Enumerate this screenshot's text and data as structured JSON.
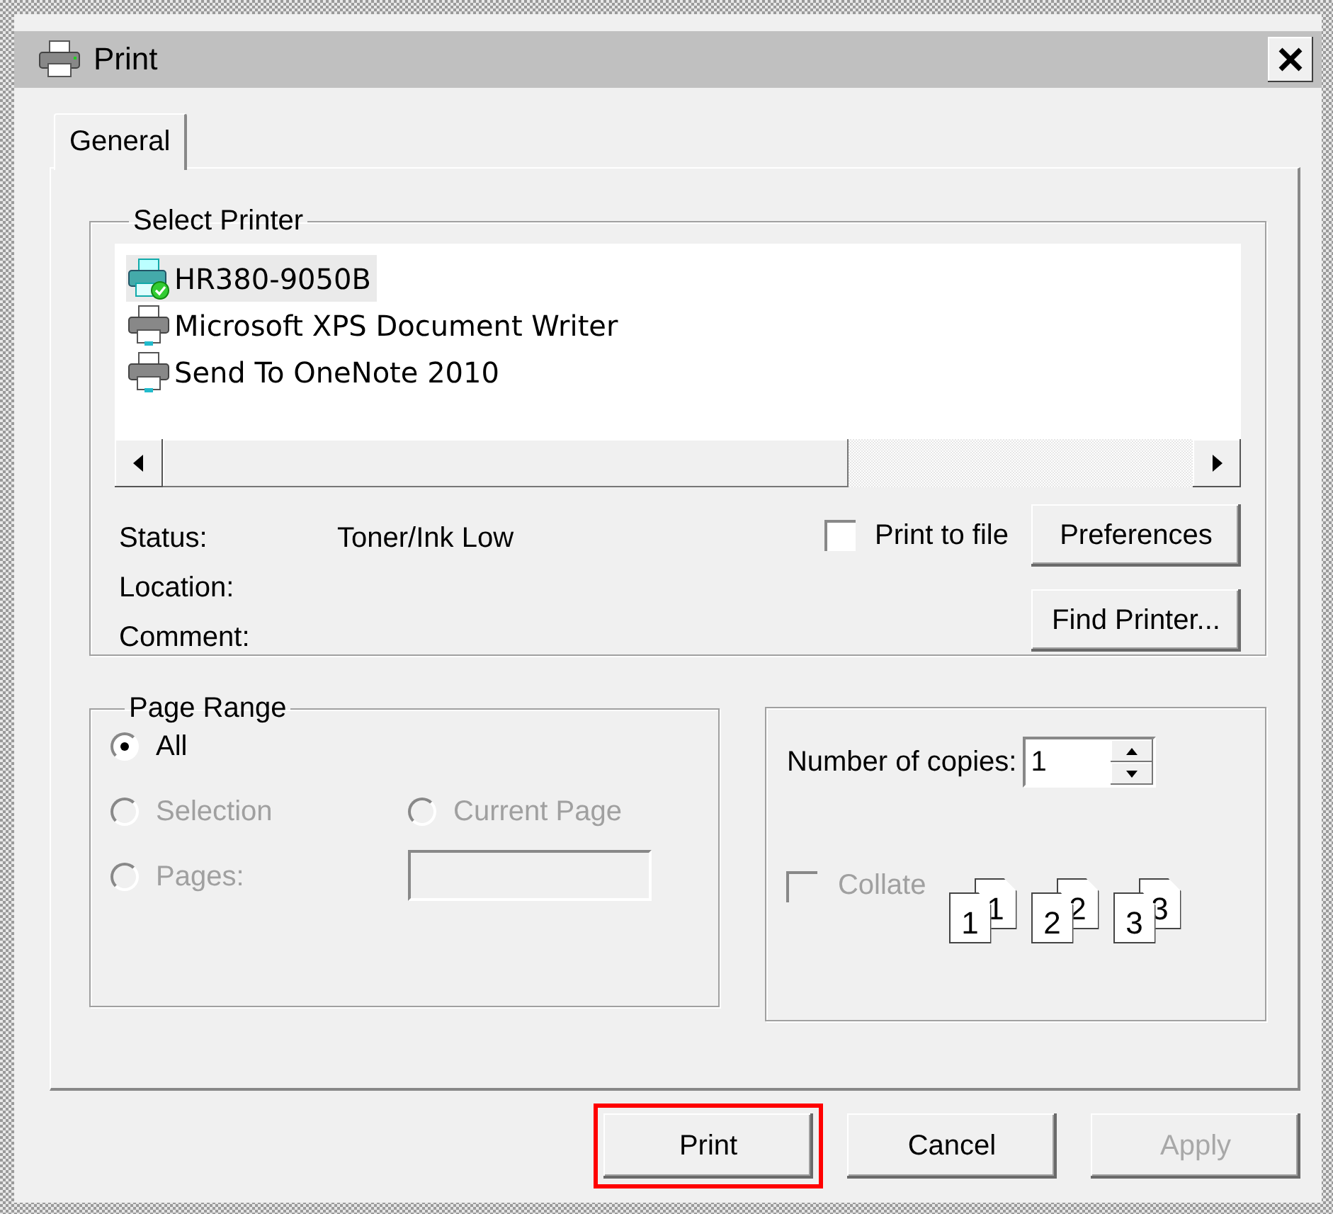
{
  "window": {
    "title": "Print"
  },
  "tabs": [
    {
      "label": "General",
      "selected": true
    }
  ],
  "select_printer": {
    "title": "Select Printer",
    "printers": [
      {
        "name": "HR380-9050B",
        "kind": "network",
        "selected": true
      },
      {
        "name": "Microsoft XPS Document Writer",
        "kind": "local",
        "selected": false
      },
      {
        "name": "Send To OneNote 2010",
        "kind": "local",
        "selected": false
      }
    ],
    "info": [
      {
        "label": "Status:",
        "value": "Toner/Ink Low"
      },
      {
        "label": "Location:"
      },
      {
        "label": "Comment:"
      }
    ],
    "print_to_file": {
      "label": "Print to file",
      "checked": false
    },
    "buttons": [
      "Preferences",
      "Find Printer..."
    ]
  },
  "page_range": {
    "title": "Page Range",
    "options": [
      {
        "label": "All",
        "selected": true,
        "disabled": false
      },
      {
        "label": "Selection",
        "selected": false,
        "disabled": true
      },
      {
        "label": "Current Page",
        "selected": false,
        "disabled": true
      },
      {
        "label": "Pages:",
        "selected": false,
        "disabled": true
      }
    ],
    "pages_field": {
      "disabled": true
    }
  },
  "copies": {
    "label": "Number of copies:",
    "value": "1",
    "collate": {
      "label": "Collate",
      "checked": false,
      "disabled": true
    },
    "collate_sets": [
      {
        "back": "1",
        "front": "1"
      },
      {
        "back": "2",
        "front": "2"
      },
      {
        "back": "3",
        "front": "3"
      }
    ]
  },
  "footer_buttons": [
    {
      "label": "Print",
      "disabled": false,
      "highlighted": true
    },
    {
      "label": "Cancel",
      "disabled": false,
      "highlighted": false
    },
    {
      "label": "Apply",
      "disabled": true,
      "highlighted": false
    }
  ]
}
